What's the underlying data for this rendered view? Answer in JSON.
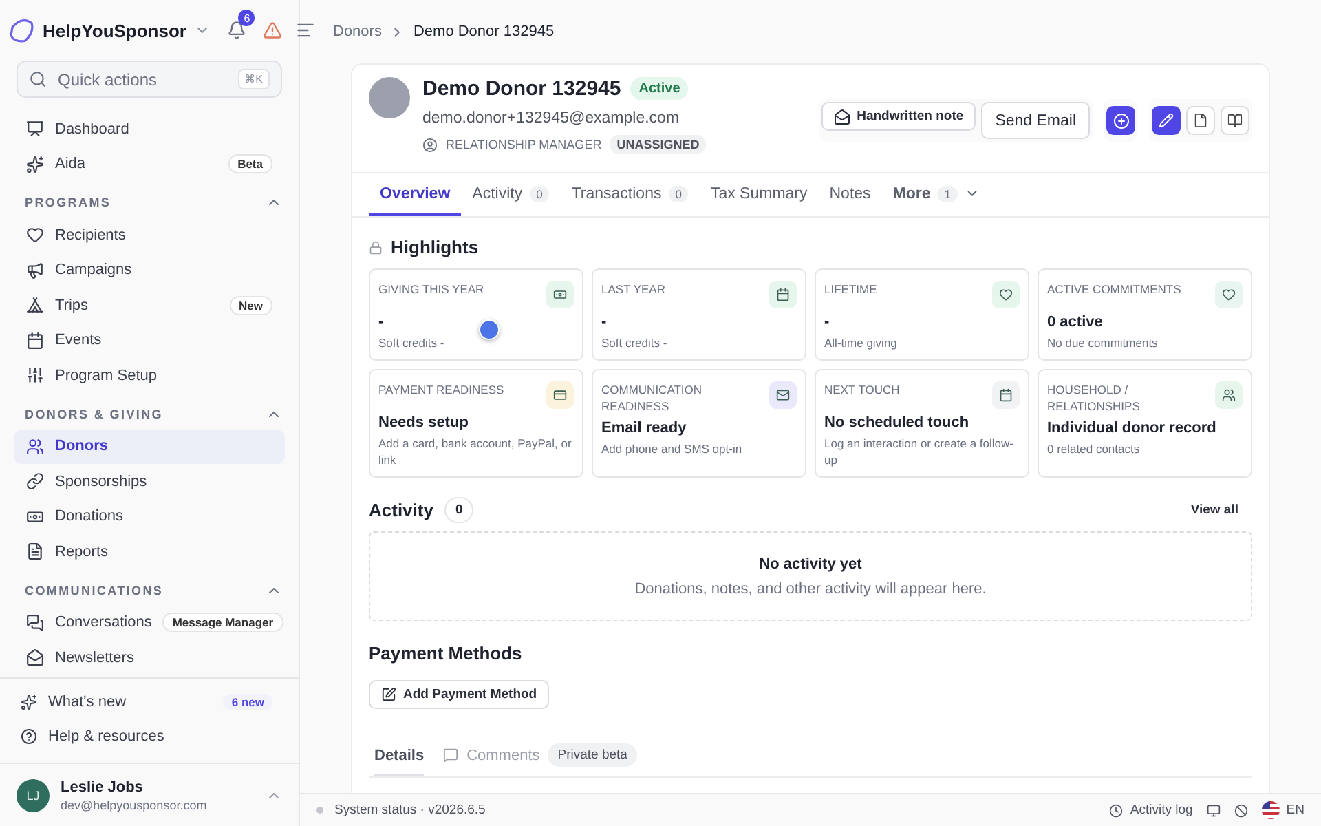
{
  "sidebar": {
    "brand": "HelpYouSponsor",
    "notifications": "6",
    "search": {
      "placeholder": "Quick actions",
      "shortcut": "⌘K"
    },
    "top_items": [
      {
        "label": "Dashboard",
        "selected": false
      },
      {
        "label": "Aida",
        "badge": "Beta",
        "selected": false
      }
    ],
    "sections": [
      {
        "title": "PROGRAMS",
        "expanded": true,
        "items": [
          {
            "label": "Recipients",
            "selected": false
          },
          {
            "label": "Campaigns",
            "selected": false
          },
          {
            "label": "Trips",
            "badge": "New",
            "selected": false
          },
          {
            "label": "Events",
            "selected": false
          },
          {
            "label": "Program Setup",
            "selected": false
          }
        ]
      },
      {
        "title": "DONORS & GIVING",
        "expanded": true,
        "items": [
          {
            "label": "Donors",
            "selected": true
          },
          {
            "label": "Sponsorships",
            "selected": false
          },
          {
            "label": "Donations",
            "selected": false
          },
          {
            "label": "Reports",
            "selected": false
          }
        ]
      },
      {
        "title": "COMMUNICATIONS",
        "expanded": true,
        "items": [
          {
            "label": "Conversations",
            "badge": "Message Manager",
            "selected": false
          },
          {
            "label": "Newsletters",
            "selected": false
          }
        ]
      }
    ],
    "footer_items": [
      {
        "label": "What's new",
        "badge": "6 new"
      },
      {
        "label": "Help & resources"
      }
    ],
    "user": {
      "initials": "LJ",
      "name": "Leslie Jobs",
      "email": "dev@helpyousponsor.com"
    }
  },
  "breadcrumb": [
    "Donors",
    "Demo Donor 132945"
  ],
  "donor": {
    "name": "Demo Donor 132945",
    "status": "Active",
    "email": "demo.donor+132945@example.com",
    "manager_label": "RELATIONSHIP MANAGER",
    "manager_value": "UNASSIGNED"
  },
  "actions": [
    "Handwritten note",
    "Send Email"
  ],
  "tabs": [
    {
      "label": "Overview",
      "selected": true
    },
    {
      "label": "Activity",
      "count": "0",
      "selected": false
    },
    {
      "label": "Transactions",
      "count": "0",
      "selected": false
    },
    {
      "label": "Tax Summary",
      "selected": false
    },
    {
      "label": "Notes",
      "selected": false
    },
    {
      "label": "More",
      "count": "1",
      "selected": false,
      "dropdown": true
    }
  ],
  "highlights": {
    "title": "Highlights",
    "cards": [
      {
        "label": "GIVING THIS YEAR",
        "value": "-",
        "sub": "Soft credits -",
        "color": "#e6f6ec"
      },
      {
        "label": "LAST YEAR",
        "value": "-",
        "sub": "Soft credits -",
        "color": "#e6f6ec"
      },
      {
        "label": "LIFETIME",
        "value": "-",
        "sub": "All-time giving",
        "color": "#e6f6ec"
      },
      {
        "label": "ACTIVE COMMITMENTS",
        "value": "0 active",
        "sub": "No due commitments",
        "color": "#e9f5f1"
      },
      {
        "label": "PAYMENT READINESS",
        "value": "Needs setup",
        "sub": "Add a card, bank account, PayPal, or link",
        "color": "#fbf3dc"
      },
      {
        "label": "COMMUNICATION READINESS",
        "value": "Email ready",
        "sub": "Add phone and SMS opt-in",
        "color": "#e9e9fb"
      },
      {
        "label": "NEXT TOUCH",
        "value": "No scheduled touch",
        "sub": "Log an interaction or create a follow-up",
        "color": "#f1f2f4"
      },
      {
        "label": "HOUSEHOLD / RELATIONSHIPS",
        "value": "Individual donor record",
        "sub": "0 related contacts",
        "color": "#e6f6ec"
      }
    ]
  },
  "activity": {
    "title": "Activity",
    "count": "0",
    "view_all": "View all",
    "empty_title": "No activity yet",
    "empty_text": "Donations, notes, and other activity will appear here."
  },
  "payment_methods": {
    "title": "Payment Methods",
    "button": "Add Payment Method"
  },
  "bottom_tabs": [
    {
      "label": "Details",
      "selected": true
    },
    {
      "label": "Comments",
      "badge": "Private beta",
      "selected": false
    }
  ],
  "status_bar": {
    "status": "System status · v2026.6.5",
    "activity_log": "Activity log",
    "language": "EN"
  }
}
